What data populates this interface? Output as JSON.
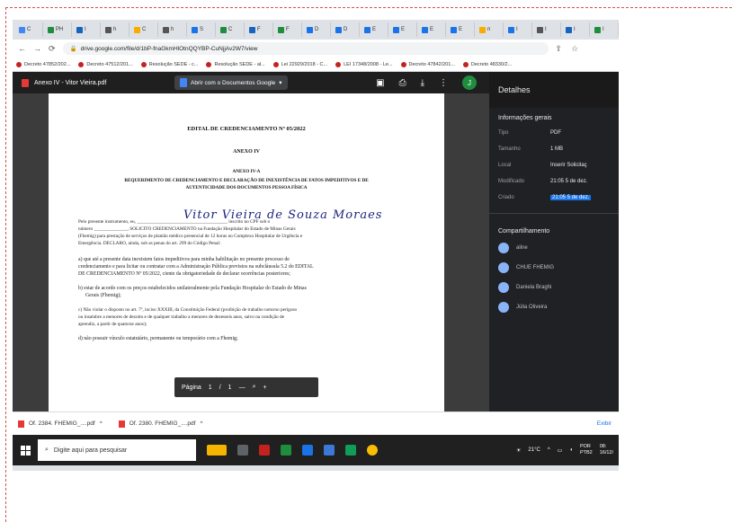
{
  "tabs": [
    {
      "icon": "doc-icon",
      "label": "C",
      "color": "#4285f4"
    },
    {
      "icon": "doc-icon",
      "label": "PH",
      "color": "#1e8e3e"
    },
    {
      "icon": "doc-icon",
      "label": "I",
      "color": "#1565c0"
    },
    {
      "icon": "doc-icon",
      "label": "h",
      "color": "#555555"
    },
    {
      "icon": "doc-icon",
      "label": "C",
      "color": "#f9ab00"
    },
    {
      "icon": "doc-icon",
      "label": "h",
      "color": "#555555"
    },
    {
      "icon": "doc-icon",
      "label": "S",
      "color": "#1a73e8"
    },
    {
      "icon": "doc-icon",
      "label": "C",
      "color": "#1e8e3e"
    },
    {
      "icon": "doc-icon",
      "label": "F",
      "color": "#1565c0"
    },
    {
      "icon": "doc-icon",
      "label": "F",
      "color": "#1e8e3e"
    },
    {
      "icon": "doc-icon",
      "label": "D",
      "color": "#1a73e8"
    },
    {
      "icon": "doc-icon",
      "label": "D",
      "color": "#1a73e8"
    },
    {
      "icon": "doc-icon",
      "label": "E",
      "color": "#1a73e8"
    },
    {
      "icon": "doc-icon",
      "label": "E",
      "color": "#1a73e8"
    },
    {
      "icon": "doc-icon",
      "label": "E",
      "color": "#1a73e8"
    },
    {
      "icon": "doc-icon",
      "label": "E",
      "color": "#1a73e8"
    },
    {
      "icon": "doc-icon",
      "label": "n",
      "color": "#f9ab00"
    },
    {
      "icon": "doc-icon",
      "label": "I",
      "color": "#1a73e8"
    },
    {
      "icon": "doc-icon",
      "label": "I",
      "color": "#555555"
    },
    {
      "icon": "doc-icon",
      "label": "I",
      "color": "#1565c0"
    },
    {
      "icon": "doc-icon",
      "label": "I",
      "color": "#1e8e3e"
    }
  ],
  "active_tab": {
    "label": "A",
    "close": "✕"
  },
  "new_tab_label": "+",
  "address_bar": {
    "url": "drive.google.com/file/d/1bP-fnaGkmHlOtnQQYBP-CuNjjAv2W7/view"
  },
  "bookmarks": [
    {
      "label": "Decreto 47852/202..."
    },
    {
      "label": "Decreto 47512/201..."
    },
    {
      "label": "Resolução SEDE - c..."
    },
    {
      "label": "Resolução SEDE - al..."
    },
    {
      "label": "Lei 22929/2018 - C..."
    },
    {
      "label": "LEI 17348/2008 - Le..."
    },
    {
      "label": "Decreto 47842/201..."
    },
    {
      "label": "Decreto 48330/2..."
    }
  ],
  "viewer": {
    "file_name": "Anexo IV - Vitor Vieira.pdf",
    "open_with_label": "Abrir com o Documentos Google",
    "avatar_letter": "J"
  },
  "pdf": {
    "title": "EDITAL DE CREDENCIAMENTO Nº 05/2022",
    "annex": "ANEXO IV",
    "annex_a": "ANEXO IV-A",
    "heading_1": "REQUERIMENTO DE CREDENCIAMENTO E DECLARAÇÃO DE INEXISTÊNCIA DE FATOS IMPEDITIVOS E DE",
    "heading_2": "AUTENTICIDADE DOS DOCUMENTOS PESSOA FÍSICA",
    "signature_name": "Vitor Vieira de Souza Moraes",
    "intro_1": "Pelo presente instrumento, eu, ______________________________________ inscrito no CPF sob o",
    "intro_2": "número ______________, SOLICITO CREDENCIAMENTO na Fundação Hospitalar do Estado de Minas Gerais",
    "intro_3": "(Fhemig) para prestação de serviços de plantão médico presencial de 12 horas no Complexo Hospitalar de Urgência e",
    "intro_4": "Emergência. DECLARO, ainda, sob as penas do art. 299 do Código Penal:",
    "item_a_1": "a) que até a presente data inexistem fatos impeditivos para minha habilitação no presente processo de",
    "item_a_2": "credenciamento e para licitar ou contratar com a Administração Pública previstos na subcláusula 5.2 do EDITAL",
    "item_a_3": "DE CREDENCIAMENTO Nº 05/2022, ciente da obrigatoriedade de declarar ocorrências posteriores;",
    "item_b_1": "b) estar de acordo com os preços estabelecidos unilateralmente pela Fundação Hospitalar do Estado de Minas",
    "item_b_2": "Gerais (Fhemig);",
    "item_c_1": "c) Não violar o disposto no art. 7º, inciso XXXIII, da Constituição Federal (proibição de trabalho noturno perigoso",
    "item_c_2": "ou insalubre a menores de dezoito e de qualquer trabalho a menores de dezesseis anos, salvo na condição de",
    "item_c_3": "aprendiz, a partir de quatorze anos);",
    "item_d_1": "d) não possuir vínculo estatutário, permanente ou temporário com a Fhemig;"
  },
  "page_control": {
    "label": "Página",
    "current": "1",
    "sep": "/",
    "total": "1",
    "minus": "—",
    "plus": "+"
  },
  "details": {
    "title": "Detalhes",
    "general_heading": "Informações gerais",
    "rows": [
      {
        "key": "Tipo",
        "value": "PDF"
      },
      {
        "key": "Tamanho",
        "value": "1 MB"
      },
      {
        "key": "Local",
        "value": "Inserir Solicitaç"
      },
      {
        "key": "Modificado",
        "value": "21:05 5 de dez."
      },
      {
        "key": "Criado",
        "value": "21:05 5 de dez."
      }
    ],
    "sharing_heading": "Compartilhamento",
    "people": [
      "aline",
      "CHUE FHEMIG",
      "Daniela Braghi",
      "Júlia Oliveira"
    ]
  },
  "downloads": [
    {
      "label": "Of. 2384. FHEMIG_....pdf"
    },
    {
      "label": "Of. 2380. FHEMIG_....pdf"
    }
  ],
  "downloads_show_all": "Exibir",
  "taskbar": {
    "search_placeholder": "Digite aqui para pesquisar",
    "temperature": "21°C",
    "lang_1": "POR",
    "lang_2": "PTB2",
    "time": "08:",
    "date": "16/12/"
  },
  "colors": {
    "accent": "#1a73e8",
    "taskbar": "#202020",
    "panel": "#202124",
    "frame_border": "#d45050"
  }
}
